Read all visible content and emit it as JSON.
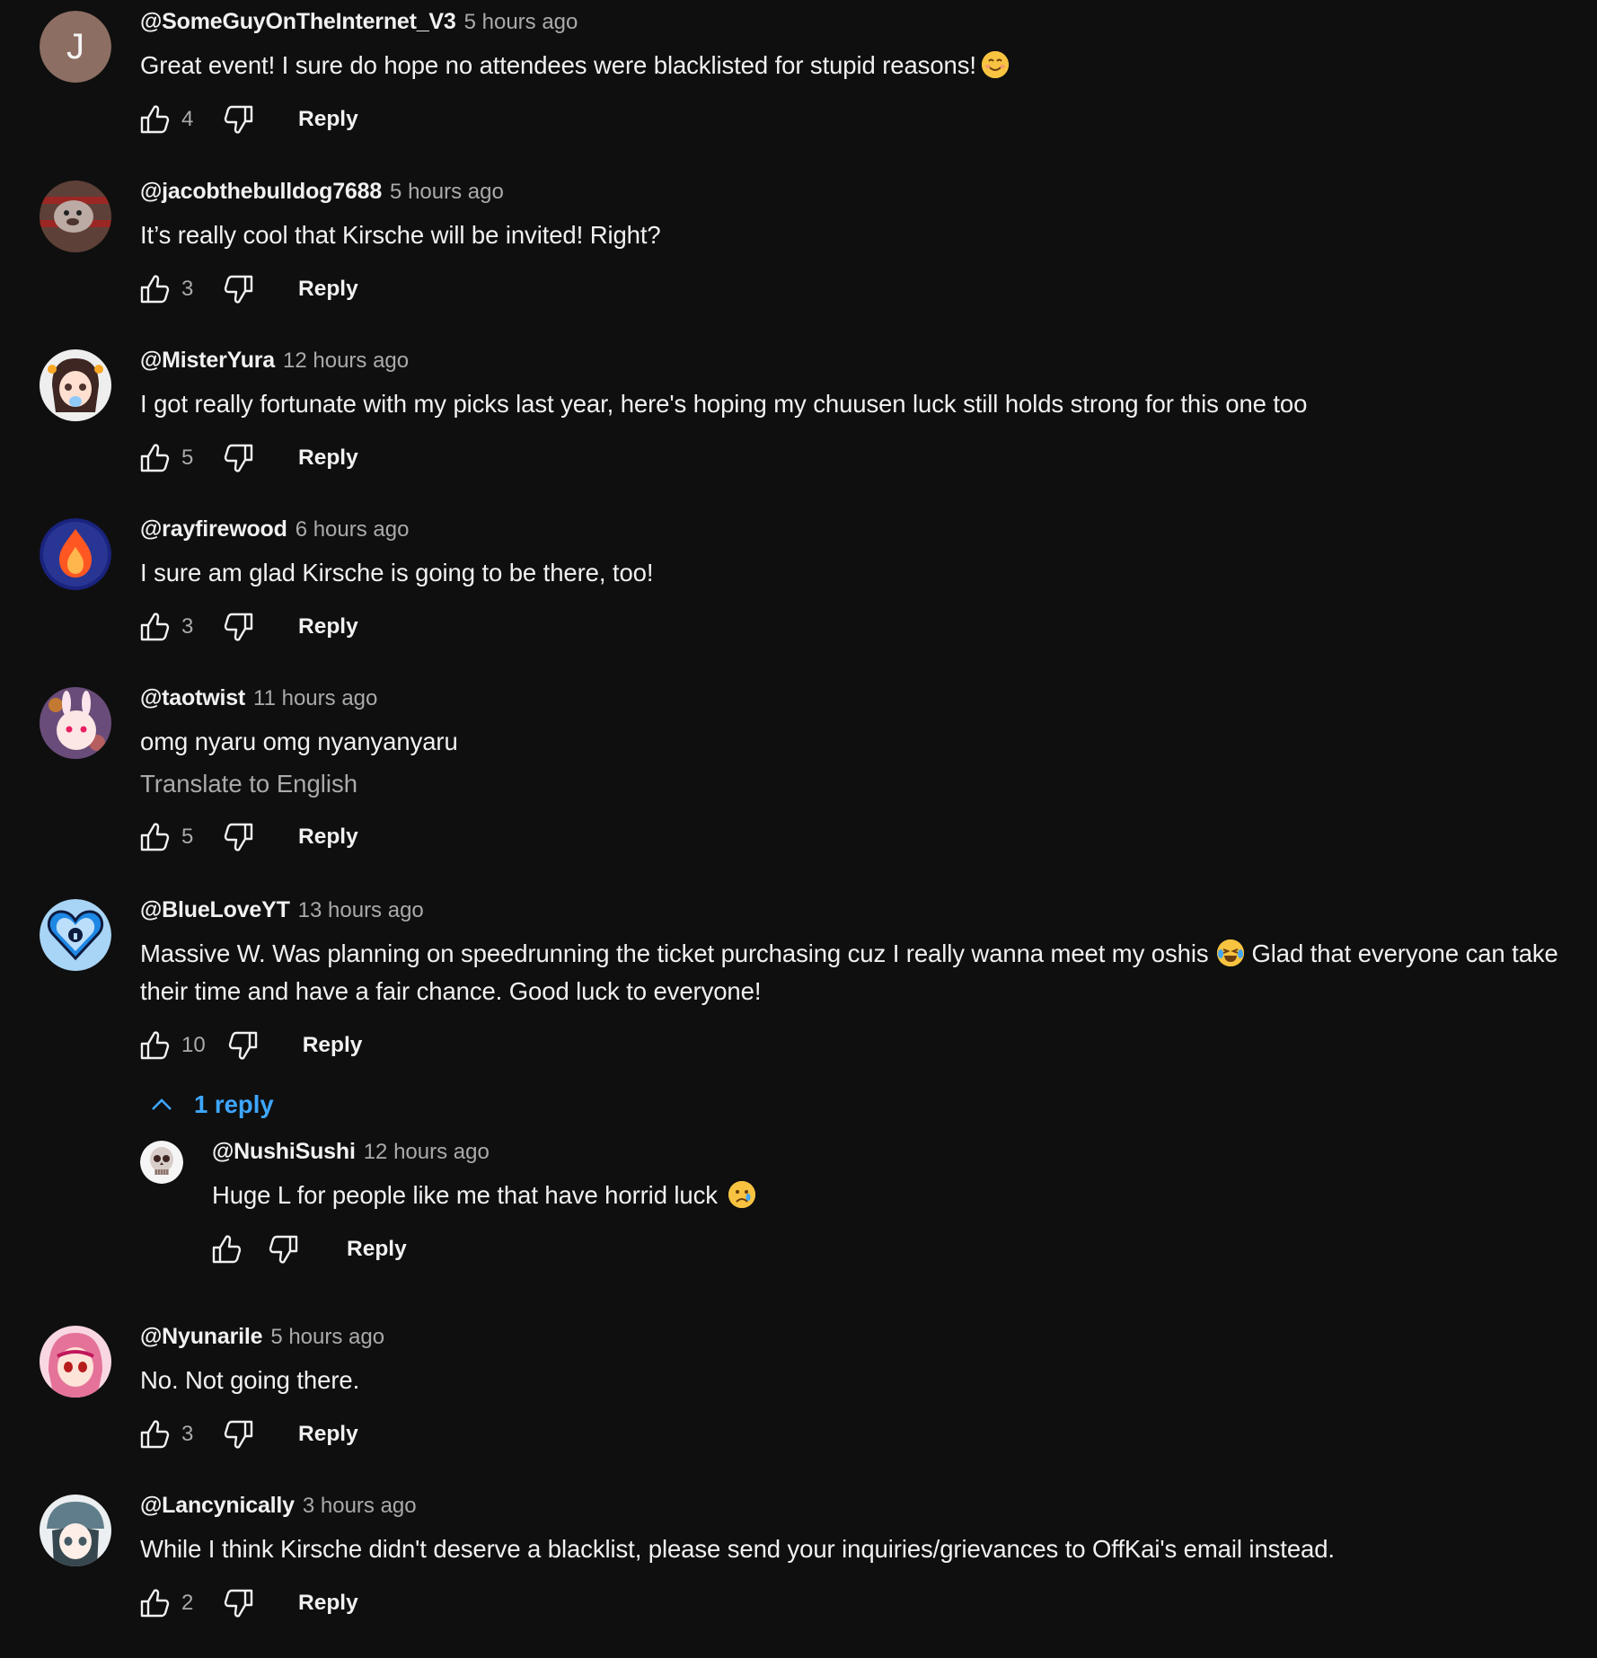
{
  "colors": {
    "background": "#0f0f0f",
    "text_primary": "#f1f1f1",
    "text_secondary": "#aaaaaa",
    "link_blue": "#3ea6ff"
  },
  "comments": [
    {
      "author": "@SomeGuyOnTheInternet_V3",
      "time": "5 hours ago",
      "text": "Great event! I sure do hope no attendees were blacklisted for stupid reasons!",
      "emoji": "smiling-face-emoji",
      "likes": "4",
      "reply_label": "Reply",
      "avatar_letter": "J",
      "avatar_color": "#8d6e63"
    },
    {
      "author": "@jacobthebulldog7688",
      "time": "5 hours ago",
      "text": "It’s really cool that Kirsche will be invited! Right?",
      "likes": "3",
      "reply_label": "Reply",
      "avatar_color": "#6d4c41"
    },
    {
      "author": "@MisterYura",
      "time": "12 hours ago",
      "text": "I got really fortunate with my picks last year, here's hoping my chuusen luck still holds strong for this one too",
      "likes": "5",
      "reply_label": "Reply",
      "avatar_color": "#e0d6d0"
    },
    {
      "author": "@rayfirewood",
      "time": "6 hours ago",
      "text": "I sure am glad Kirsche is going to be there, too!",
      "likes": "3",
      "reply_label": "Reply",
      "avatar_color": "#1a237e"
    },
    {
      "author": "@taotwist",
      "time": "11 hours ago",
      "text": "omg nyaru omg nyanyanyaru",
      "translate_label": "Translate to English",
      "likes": "5",
      "reply_label": "Reply",
      "avatar_color": "#7b5a8a"
    },
    {
      "author": "@BlueLoveYT",
      "time": "13 hours ago",
      "text_part1": "Massive W. Was planning on speedrunning the ticket purchasing cuz I really wanna meet my oshis",
      "emoji": "laughing-tears-emoji",
      "text_part2": "Glad that everyone can take their time and have a fair chance. Good luck to everyone!",
      "likes": "10",
      "reply_label": "Reply",
      "replies_label": "1 reply",
      "avatar_color": "#a8d4f5"
    },
    {
      "author": "@Nyunarile",
      "time": "5 hours ago",
      "text": "No. Not going there.",
      "likes": "3",
      "reply_label": "Reply",
      "avatar_color": "#f3c1d3"
    },
    {
      "author": "@Lancynically",
      "time": "3 hours ago",
      "text": "While I think Kirsche didn't deserve a blacklist, please send your inquiries/grievances to OffKai's email instead.",
      "likes": "2",
      "reply_label": "Reply",
      "avatar_color": "#cfd8dc"
    }
  ],
  "nested_reply": {
    "author": "@NushiSushi",
    "time": "12 hours ago",
    "text": "Huge L for people like me that have horrid luck",
    "emoji": "crying-face-emoji",
    "reply_label": "Reply",
    "avatar_color": "#d7ccc8"
  }
}
